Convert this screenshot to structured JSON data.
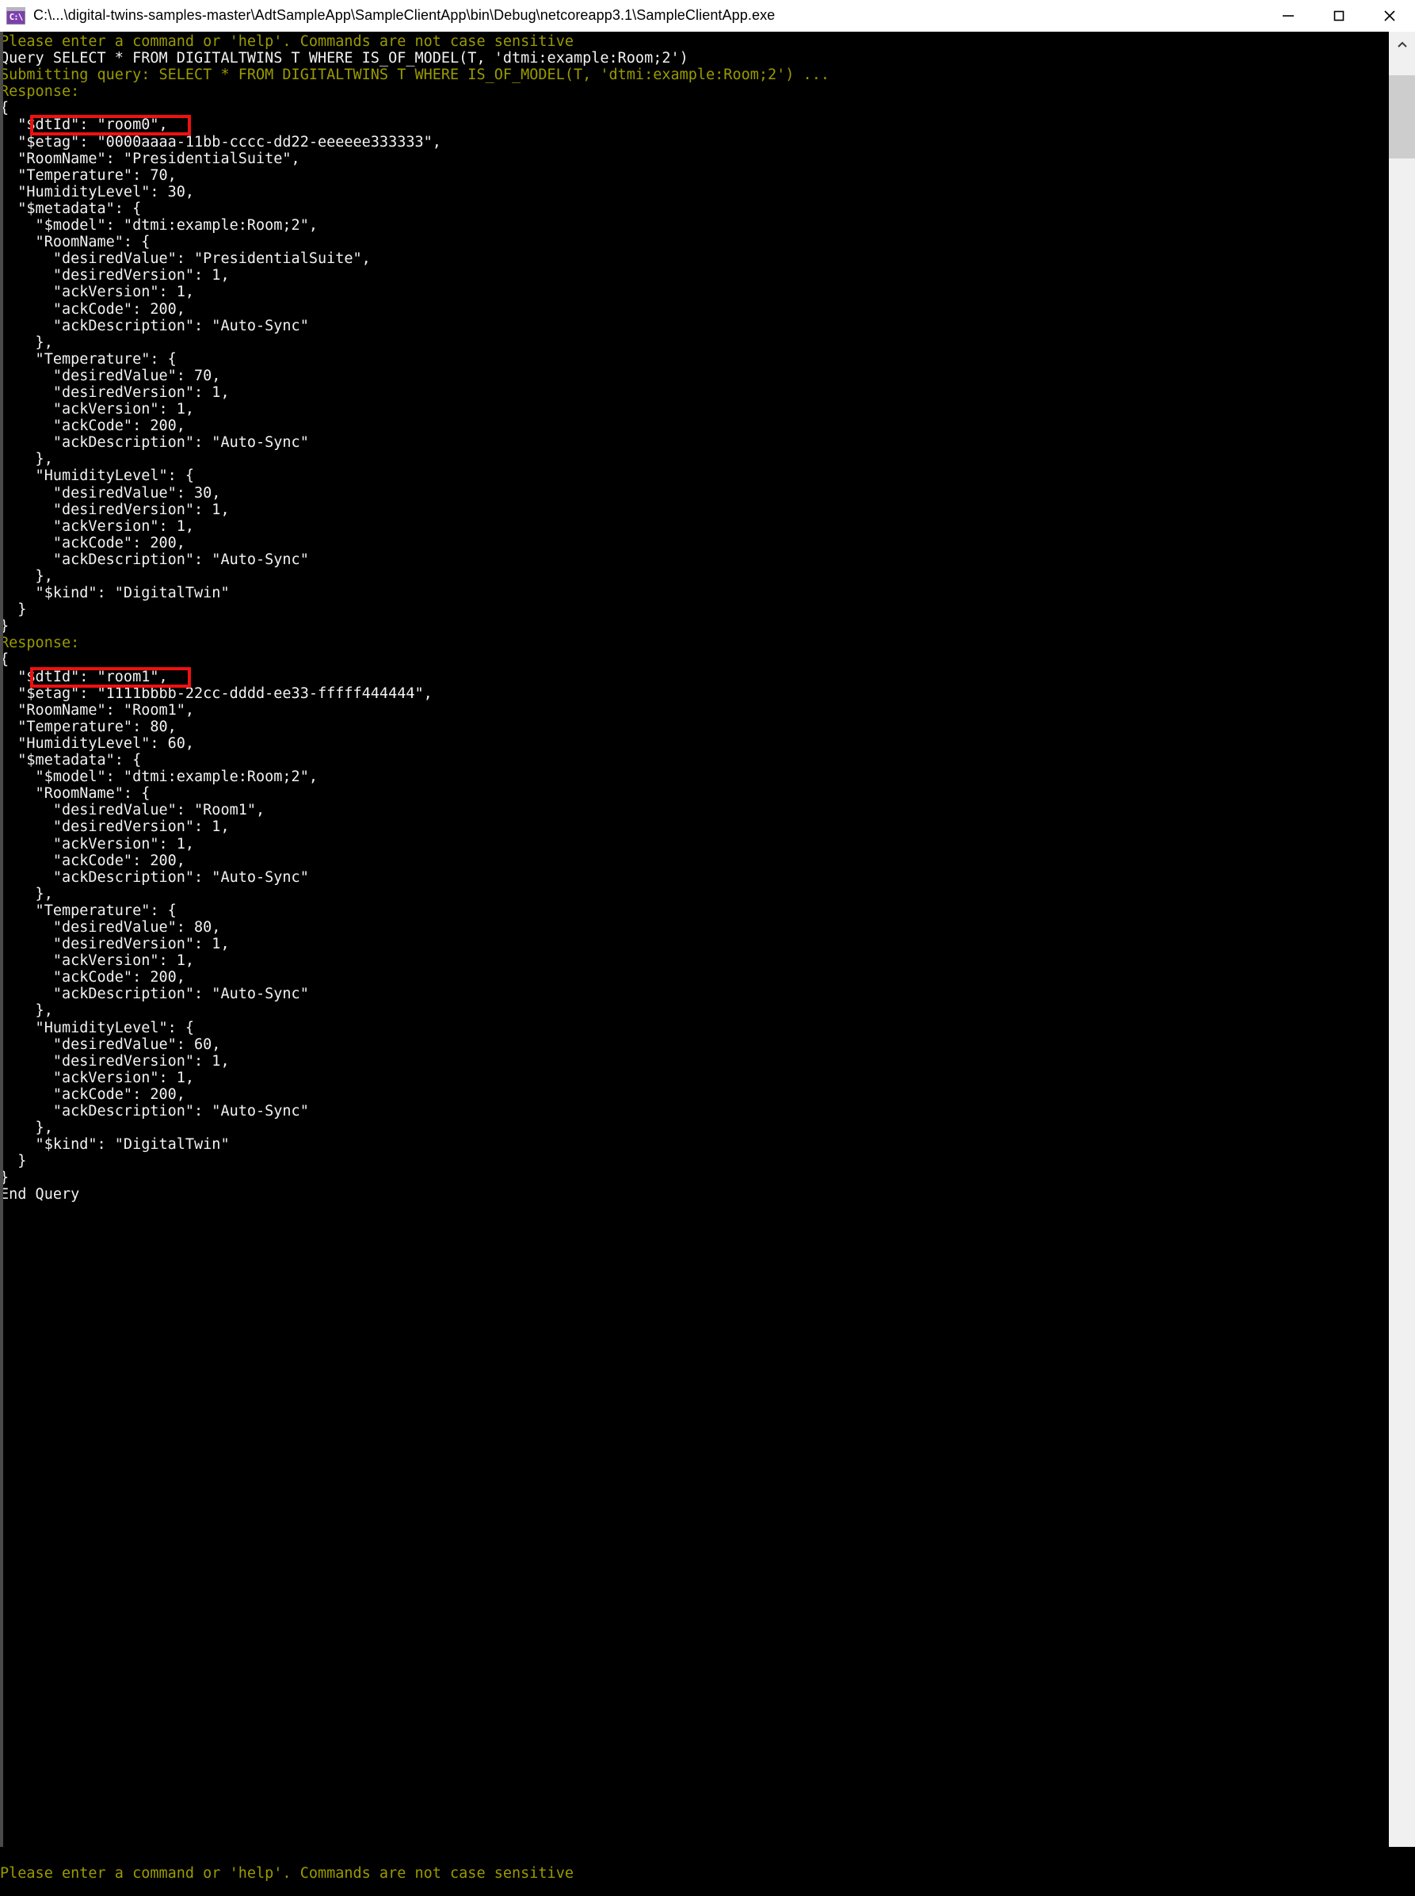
{
  "window": {
    "title": "C:\\...\\digital-twins-samples-master\\AdtSampleApp\\SampleClientApp\\bin\\Debug\\netcoreapp3.1\\SampleClientApp.exe",
    "app_icon_glyph": "C:\\",
    "controls": {
      "minimize_label": "Minimize",
      "maximize_label": "Maximize",
      "close_label": "Close"
    }
  },
  "colors": {
    "console_background": "#000000",
    "prompt_text": "#9a9a00",
    "normal_text": "#f2f2f2",
    "highlight_border": "#ee1111",
    "titlebar_background": "#ffffff",
    "scrollbar_track": "#f0f0f0",
    "scrollbar_thumb": "#cdcdcd"
  },
  "scrollbar": {
    "up_arrow_icon": "chevron-up-icon",
    "thumb_position": "near-top"
  },
  "console": {
    "lines": [
      {
        "text": "Please enter a command or 'help'. Commands are not case sensitive",
        "type": "prompt"
      },
      {
        "text": "Query SELECT * FROM DIGITALTWINS T WHERE IS_OF_MODEL(T, 'dtmi:example:Room;2')",
        "type": "cmd"
      },
      {
        "text": "Submitting query: SELECT * FROM DIGITALTWINS T WHERE IS_OF_MODEL(T, 'dtmi:example:Room;2') ...",
        "type": "prompt"
      },
      {
        "text": "Response:",
        "type": "prompt"
      },
      {
        "text": "{",
        "type": "json"
      },
      {
        "text": "  \"$dtId\": \"room0\",",
        "type": "json",
        "highlight": true
      },
      {
        "text": "  \"$etag\": \"0000aaaa-11bb-cccc-dd22-eeeeee333333\",",
        "type": "json"
      },
      {
        "text": "  \"RoomName\": \"PresidentialSuite\",",
        "type": "json"
      },
      {
        "text": "  \"Temperature\": 70,",
        "type": "json"
      },
      {
        "text": "  \"HumidityLevel\": 30,",
        "type": "json"
      },
      {
        "text": "  \"$metadata\": {",
        "type": "json"
      },
      {
        "text": "    \"$model\": \"dtmi:example:Room;2\",",
        "type": "json"
      },
      {
        "text": "    \"RoomName\": {",
        "type": "json"
      },
      {
        "text": "      \"desiredValue\": \"PresidentialSuite\",",
        "type": "json"
      },
      {
        "text": "      \"desiredVersion\": 1,",
        "type": "json"
      },
      {
        "text": "      \"ackVersion\": 1,",
        "type": "json"
      },
      {
        "text": "      \"ackCode\": 200,",
        "type": "json"
      },
      {
        "text": "      \"ackDescription\": \"Auto-Sync\"",
        "type": "json"
      },
      {
        "text": "    },",
        "type": "json"
      },
      {
        "text": "    \"Temperature\": {",
        "type": "json"
      },
      {
        "text": "      \"desiredValue\": 70,",
        "type": "json"
      },
      {
        "text": "      \"desiredVersion\": 1,",
        "type": "json"
      },
      {
        "text": "      \"ackVersion\": 1,",
        "type": "json"
      },
      {
        "text": "      \"ackCode\": 200,",
        "type": "json"
      },
      {
        "text": "      \"ackDescription\": \"Auto-Sync\"",
        "type": "json"
      },
      {
        "text": "    },",
        "type": "json"
      },
      {
        "text": "    \"HumidityLevel\": {",
        "type": "json"
      },
      {
        "text": "      \"desiredValue\": 30,",
        "type": "json"
      },
      {
        "text": "      \"desiredVersion\": 1,",
        "type": "json"
      },
      {
        "text": "      \"ackVersion\": 1,",
        "type": "json"
      },
      {
        "text": "      \"ackCode\": 200,",
        "type": "json"
      },
      {
        "text": "      \"ackDescription\": \"Auto-Sync\"",
        "type": "json"
      },
      {
        "text": "    },",
        "type": "json"
      },
      {
        "text": "    \"$kind\": \"DigitalTwin\"",
        "type": "json"
      },
      {
        "text": "  }",
        "type": "json"
      },
      {
        "text": "}",
        "type": "json"
      },
      {
        "text": "Response:",
        "type": "prompt"
      },
      {
        "text": "{",
        "type": "json"
      },
      {
        "text": "  \"$dtId\": \"room1\",",
        "type": "json",
        "highlight": true
      },
      {
        "text": "  \"$etag\": \"1111bbbb-22cc-dddd-ee33-fffff444444\",",
        "type": "json"
      },
      {
        "text": "  \"RoomName\": \"Room1\",",
        "type": "json"
      },
      {
        "text": "  \"Temperature\": 80,",
        "type": "json"
      },
      {
        "text": "  \"HumidityLevel\": 60,",
        "type": "json"
      },
      {
        "text": "  \"$metadata\": {",
        "type": "json"
      },
      {
        "text": "    \"$model\": \"dtmi:example:Room;2\",",
        "type": "json"
      },
      {
        "text": "    \"RoomName\": {",
        "type": "json"
      },
      {
        "text": "      \"desiredValue\": \"Room1\",",
        "type": "json"
      },
      {
        "text": "      \"desiredVersion\": 1,",
        "type": "json"
      },
      {
        "text": "      \"ackVersion\": 1,",
        "type": "json"
      },
      {
        "text": "      \"ackCode\": 200,",
        "type": "json"
      },
      {
        "text": "      \"ackDescription\": \"Auto-Sync\"",
        "type": "json"
      },
      {
        "text": "    },",
        "type": "json"
      },
      {
        "text": "    \"Temperature\": {",
        "type": "json"
      },
      {
        "text": "      \"desiredValue\": 80,",
        "type": "json"
      },
      {
        "text": "      \"desiredVersion\": 1,",
        "type": "json"
      },
      {
        "text": "      \"ackVersion\": 1,",
        "type": "json"
      },
      {
        "text": "      \"ackCode\": 200,",
        "type": "json"
      },
      {
        "text": "      \"ackDescription\": \"Auto-Sync\"",
        "type": "json"
      },
      {
        "text": "    },",
        "type": "json"
      },
      {
        "text": "    \"HumidityLevel\": {",
        "type": "json"
      },
      {
        "text": "      \"desiredValue\": 60,",
        "type": "json"
      },
      {
        "text": "      \"desiredVersion\": 1,",
        "type": "json"
      },
      {
        "text": "      \"ackVersion\": 1,",
        "type": "json"
      },
      {
        "text": "      \"ackCode\": 200,",
        "type": "json"
      },
      {
        "text": "      \"ackDescription\": \"Auto-Sync\"",
        "type": "json"
      },
      {
        "text": "    },",
        "type": "json"
      },
      {
        "text": "    \"$kind\": \"DigitalTwin\"",
        "type": "json"
      },
      {
        "text": "  }",
        "type": "json"
      },
      {
        "text": "}",
        "type": "json"
      },
      {
        "text": "End Query",
        "type": "json"
      }
    ],
    "bottom_lines": [
      {
        "text": "",
        "type": "spacer"
      },
      {
        "text": "Please enter a command or 'help'. Commands are not case sensitive",
        "type": "prompt"
      }
    ]
  }
}
